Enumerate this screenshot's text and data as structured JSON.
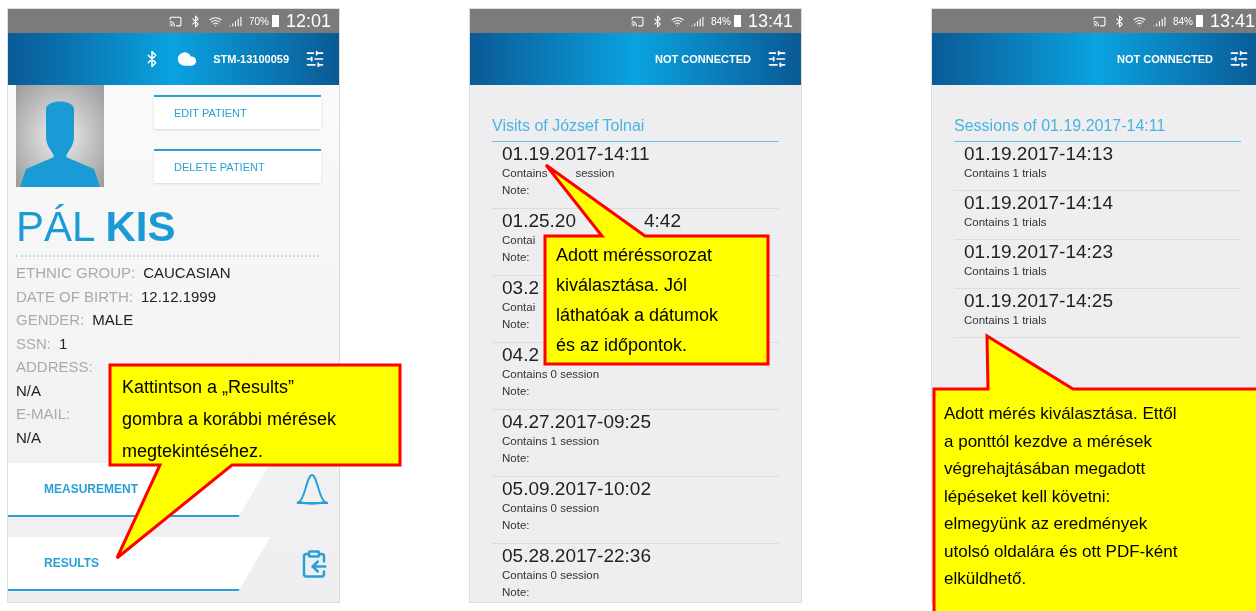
{
  "phones": [
    {
      "kind": "patient",
      "status": {
        "battery": "70%",
        "time": "12:01"
      },
      "header": {
        "connected": true,
        "device": "STM-13100059"
      },
      "edit_button": "EDIT PATIENT",
      "delete_button": "DELETE PATIENT",
      "name": "PÁL **KIS**",
      "fields": [
        {
          "label": "ETHNIC GROUP:",
          "value": "CAUCASIAN",
          "kind": "inline"
        },
        {
          "label": "DATE OF BIRTH:",
          "value": "12.12.1999",
          "kind": "inline"
        },
        {
          "label": "GENDER:",
          "value": "MALE",
          "kind": "inline"
        },
        {
          "label": "SSN:",
          "value": "1",
          "kind": "inline"
        },
        {
          "label": "ADDRESS:",
          "value": "N/A",
          "kind": "stacked"
        },
        {
          "label": "E-MAIL:",
          "value": "N/A",
          "kind": "stacked"
        }
      ],
      "actions": [
        {
          "label": "MEASUREMENT",
          "kind": "curve"
        },
        {
          "label": "RESULTS",
          "kind": "clipboard"
        }
      ]
    },
    {
      "kind": "list",
      "status": {
        "battery": "84%",
        "time": "13:41"
      },
      "header": {
        "connected": false,
        "device": "NOT CONNECTED"
      },
      "title": "Visits of József Tolnai",
      "rows": [
        {
          "date": "01.19.2017-14:11",
          "summary": "Contains",
          "summary_tail": "session",
          "note": "Note:"
        },
        {
          "date": "01.25.20",
          "date_tail": "4:42",
          "summary": "Contai",
          "note": "Note:"
        },
        {
          "date": "03.2",
          "summary": "Contai",
          "note": "Note:"
        },
        {
          "date": "04.2",
          "summary": "Contains 0 session",
          "note": "Note:"
        },
        {
          "date": "04.27.2017-09:25",
          "summary": "Contains 1 session",
          "note": "Note:"
        },
        {
          "date": "05.09.2017-10:02",
          "summary": "Contains 0 session",
          "note": "Note:"
        },
        {
          "date": "05.28.2017-22:36",
          "summary": "Contains 0 session",
          "note": "Note:"
        }
      ]
    },
    {
      "kind": "list",
      "status": {
        "battery": "84%",
        "time": "13:41"
      },
      "header": {
        "connected": false,
        "device": "NOT CONNECTED"
      },
      "title": "Sessions of 01.19.2017-14:11",
      "rows": [
        {
          "date": "01.19.2017-14:13",
          "summary": "Contains 1 trials"
        },
        {
          "date": "01.19.2017-14:14",
          "summary": "Contains 1 trials"
        },
        {
          "date": "01.19.2017-14:23",
          "summary": "Contains 1 trials"
        },
        {
          "date": "01.19.2017-14:25",
          "summary": "Contains 1 trials"
        }
      ]
    }
  ],
  "callouts": [
    {
      "text": "Kattintson a „Results”\ngombra a korábbi mérések\nmegtekintéséhez."
    },
    {
      "text": "Adott méréssorozat\nkiválasztása. Jól\nláthatóak a dátumok\nés az időpontok."
    },
    {
      "text": "Adott mérés kiválasztása. Ettől\na ponttól kezdve a mérések\nvégrehajtásában megadott\nlépéseket kell követni:\nelmegyünk az eredmények\nutolsó oldalára és ott PDF-ként\nelküldhető."
    }
  ]
}
